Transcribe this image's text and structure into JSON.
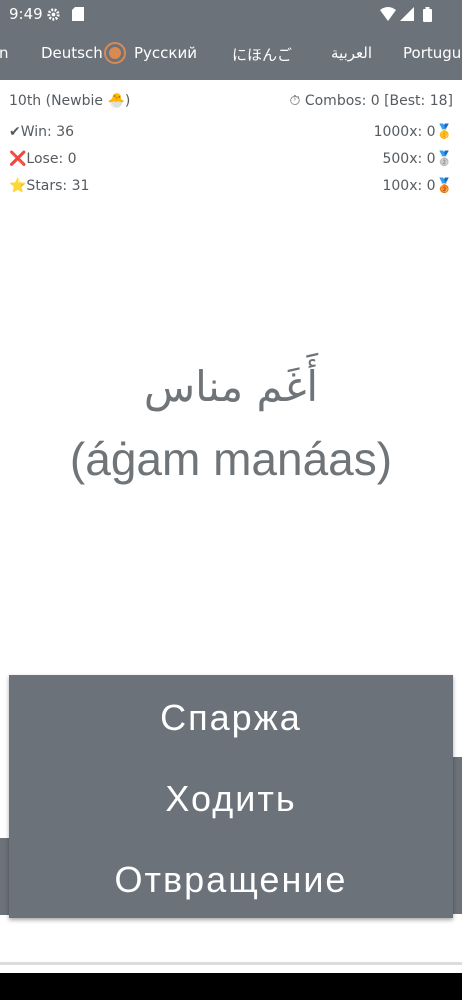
{
  "status_bar": {
    "time": "9:49",
    "icons": [
      "gear-icon",
      "sd-card-icon",
      "wifi-icon",
      "signal-icon",
      "battery-icon"
    ]
  },
  "language_tabs": [
    {
      "label": "n"
    },
    {
      "label": "Deutsch"
    },
    {
      "label": "Русский",
      "selected": true
    },
    {
      "label": "にほんご"
    },
    {
      "label": "العربية"
    },
    {
      "label": "Portugue"
    }
  ],
  "stats": {
    "rank": "10th (Newbie 🐣)",
    "combos": "⏱ Combos: 0 [Best: 18]",
    "win": "✔Win: 36",
    "lose": "❌Lose: 0",
    "stars": "⭐Stars: 31",
    "gold": "1000x: 0🥇",
    "silver": "500x: 0🥈",
    "bronze": "100x: 0🥉"
  },
  "word": {
    "arabic": "أَغَم مناس",
    "transliteration": "(áġam manáas)"
  },
  "answers": [
    "Спаржа",
    "Ходить",
    "Отвращение"
  ],
  "colors": {
    "bar": "#6b7279",
    "accent": "#d98a53",
    "text": "#555b60"
  }
}
